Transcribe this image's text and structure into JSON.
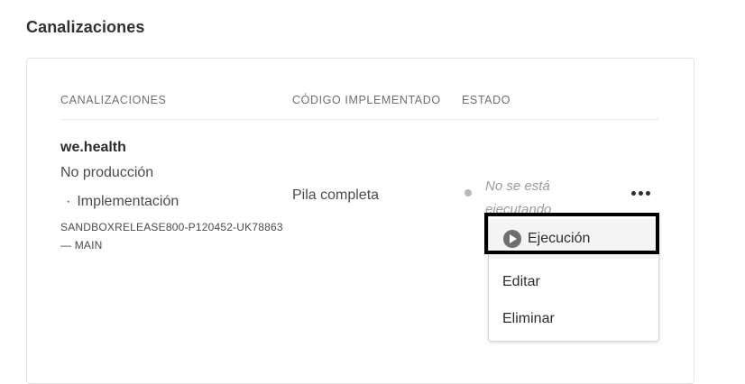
{
  "page": {
    "section_title": "Canalizaciones"
  },
  "table": {
    "headers": [
      "CANALIZACIONES",
      "CÓDIGO IMPLEMENTADO",
      "ESTADO"
    ],
    "rows": [
      {
        "name": "we.health",
        "environment": "No producción",
        "type_bullet": "·",
        "type": "Implementación",
        "branch_line1": "SANDBOXRELEASE800-P120452-UK78863",
        "branch_line2": "— MAIN",
        "deployed_code": "Pila completa",
        "status": "No se está ejecutando",
        "status_color": "#b8b8b8"
      }
    ]
  },
  "actions_menu": {
    "items": [
      {
        "label": "Ejecución",
        "icon": "play-icon"
      },
      {
        "label": "Editar"
      },
      {
        "label": "Eliminar"
      }
    ],
    "highlight_color": "#000000"
  }
}
